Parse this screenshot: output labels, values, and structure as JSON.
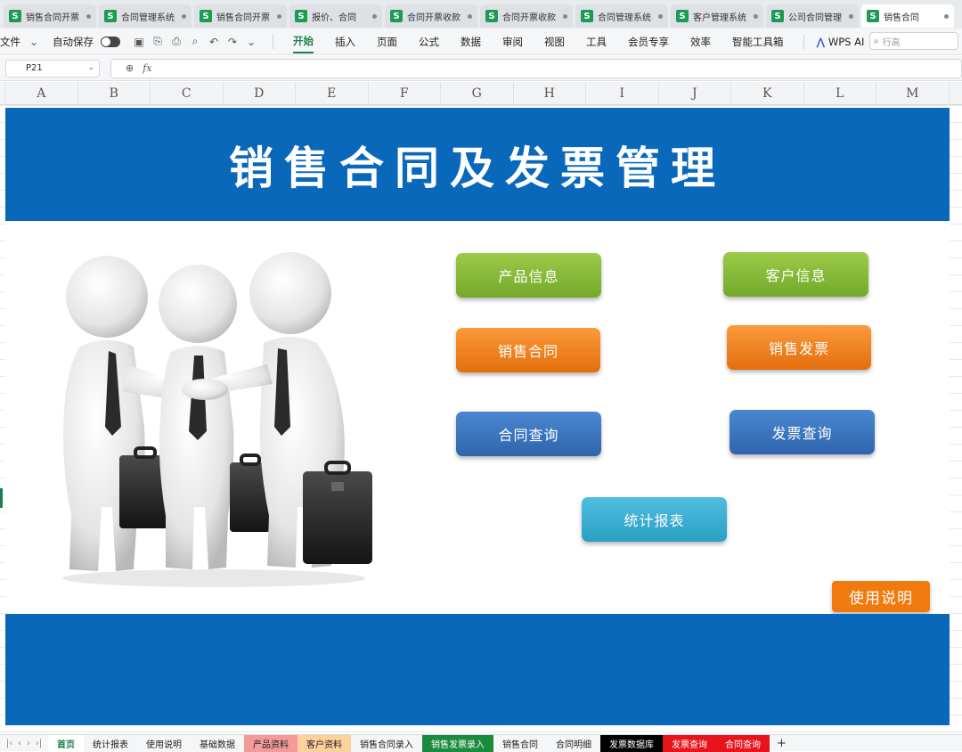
{
  "doc_tabs": [
    {
      "label": "销售合同开票"
    },
    {
      "label": "合同管理系统"
    },
    {
      "label": "销售合同开票"
    },
    {
      "label": "报价、合同"
    },
    {
      "label": "合同开票收款"
    },
    {
      "label": "合同开票收款"
    },
    {
      "label": "合同管理系统"
    },
    {
      "label": "客户管理系统"
    },
    {
      "label": "公司合同管理"
    },
    {
      "label": "销售合同"
    }
  ],
  "menubar": {
    "file": "文件",
    "autosave": "自动保存",
    "items": [
      {
        "label": "开始"
      },
      {
        "label": "插入"
      },
      {
        "label": "页面"
      },
      {
        "label": "公式"
      },
      {
        "label": "数据"
      },
      {
        "label": "审阅"
      },
      {
        "label": "视图"
      },
      {
        "label": "工具"
      },
      {
        "label": "会员专享"
      },
      {
        "label": "效率"
      },
      {
        "label": "智能工具箱"
      }
    ],
    "wps_ai": "WPS AI",
    "search_placeholder": "行高"
  },
  "formula_bar": {
    "cell_ref": "P21",
    "fx": "fx"
  },
  "columns": [
    "A",
    "B",
    "C",
    "D",
    "E",
    "F",
    "G",
    "H",
    "I",
    "J",
    "K",
    "L",
    "M"
  ],
  "dashboard": {
    "title": "销售合同及发票管理",
    "buttons": {
      "product_info": "产品信息",
      "customer_info": "客户信息",
      "sales_contract": "销售合同",
      "sales_invoice": "销售发票",
      "contract_query": "合同查询",
      "invoice_query": "发票查询",
      "stats_report": "统计报表",
      "usage_guide": "使用说明"
    }
  },
  "sheet_tabs": [
    {
      "label": "首页",
      "color": "#ffffff"
    },
    {
      "label": "统计报表",
      "color": "#f5f6f7"
    },
    {
      "label": "使用说明",
      "color": "#f5f6f7"
    },
    {
      "label": "基础数据",
      "color": "#f5f6f7"
    },
    {
      "label": "产品资料",
      "color": "#f39a9a"
    },
    {
      "label": "客户资料",
      "color": "#fcd19c"
    },
    {
      "label": "销售合同录入",
      "color": "#f5f6f7"
    },
    {
      "label": "销售发票录入",
      "color": "#1a8a3c"
    },
    {
      "label": "销售合同",
      "color": "#f5f6f7"
    },
    {
      "label": "合同明细",
      "color": "#f5f6f7"
    },
    {
      "label": "发票数据库",
      "color": "#000000"
    },
    {
      "label": "发票查询",
      "color": "#e8141c"
    },
    {
      "label": "合同查询",
      "color": "#e8141c"
    }
  ],
  "sheet_add": "+"
}
